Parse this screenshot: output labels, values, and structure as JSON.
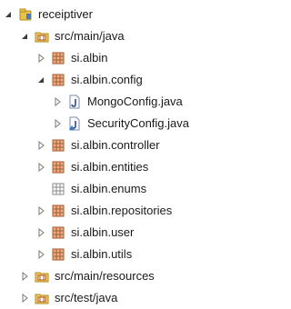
{
  "tree": {
    "project": {
      "label": "receiptiver",
      "expanded": true
    },
    "nodes": [
      {
        "label": "src/main/java",
        "type": "source-folder",
        "expanded": true
      },
      {
        "label": "si.albin",
        "type": "package",
        "expanded": false
      },
      {
        "label": "si.albin.config",
        "type": "package",
        "expanded": true
      },
      {
        "label": "MongoConfig.java",
        "type": "java-file",
        "expanded": false
      },
      {
        "label": "SecurityConfig.java",
        "type": "java-file",
        "expanded": false
      },
      {
        "label": "si.albin.controller",
        "type": "package",
        "expanded": false
      },
      {
        "label": "si.albin.entities",
        "type": "package",
        "expanded": false
      },
      {
        "label": "si.albin.enums",
        "type": "empty-package",
        "expanded": false
      },
      {
        "label": "si.albin.repositories",
        "type": "package",
        "expanded": false
      },
      {
        "label": "si.albin.user",
        "type": "package",
        "expanded": false
      },
      {
        "label": "si.albin.utils",
        "type": "package",
        "expanded": false
      },
      {
        "label": "src/main/resources",
        "type": "source-folder",
        "expanded": false
      },
      {
        "label": "src/test/java",
        "type": "source-folder",
        "expanded": false
      }
    ]
  },
  "colors": {
    "package": "#a85a2a",
    "source_folder": "#d9a441",
    "java": "#2b4e8a",
    "twisty": "#7a7a7a"
  }
}
